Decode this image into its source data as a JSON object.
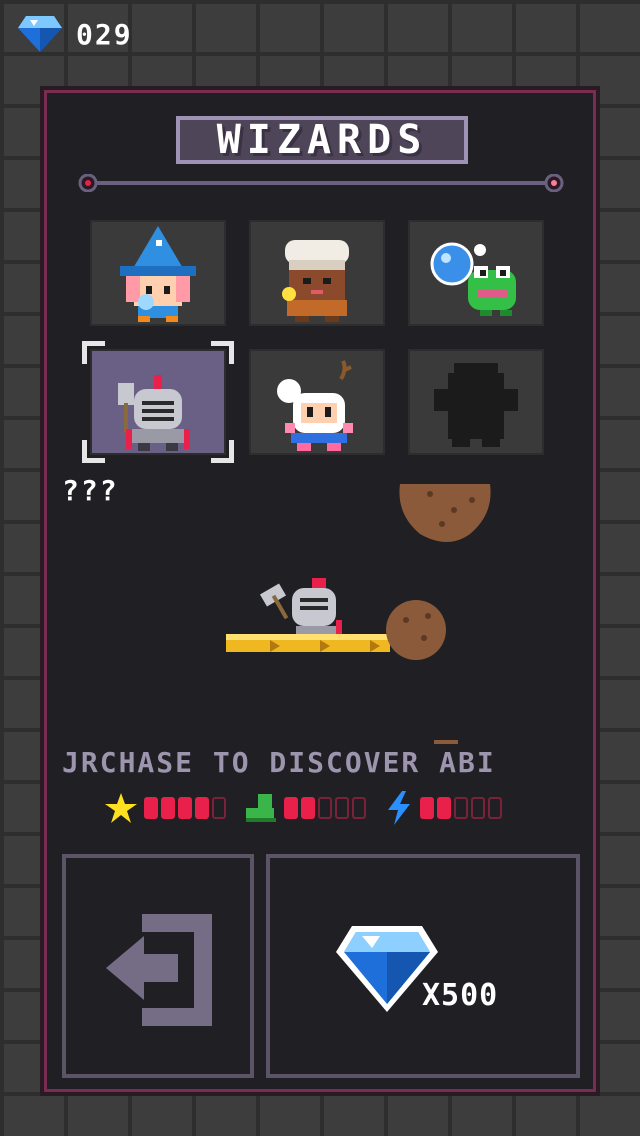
{
  "hud": {
    "gem_count": "029",
    "gem_icon": "diamond-gem-icon"
  },
  "panel": {
    "title": "WIZARDS"
  },
  "characters": [
    {
      "name": "blue-wizard",
      "locked": false,
      "selected": false
    },
    {
      "name": "turban-wizard",
      "locked": false,
      "selected": false
    },
    {
      "name": "bubble-frog",
      "locked": false,
      "selected": false
    },
    {
      "name": "knight",
      "locked": false,
      "selected": true
    },
    {
      "name": "bomber",
      "locked": false,
      "selected": false
    },
    {
      "name": "locked-silhouette",
      "locked": true,
      "selected": false
    }
  ],
  "selection": {
    "name_label": "???"
  },
  "info": {
    "ticker_text": "JRCHASE TO DISCOVER ABI"
  },
  "stats": [
    {
      "icon": "star-icon",
      "color": "#ffe020",
      "filled": 4,
      "total": 5
    },
    {
      "icon": "boot-icon",
      "color": "#3ab54a",
      "filled": 2,
      "total": 5
    },
    {
      "icon": "lightning-icon",
      "color": "#2a90ff",
      "filled": 2,
      "total": 5
    }
  ],
  "buttons": {
    "exit_icon": "exit-arrow-icon",
    "buy_icon": "diamond-gem-icon",
    "price": "X500"
  }
}
